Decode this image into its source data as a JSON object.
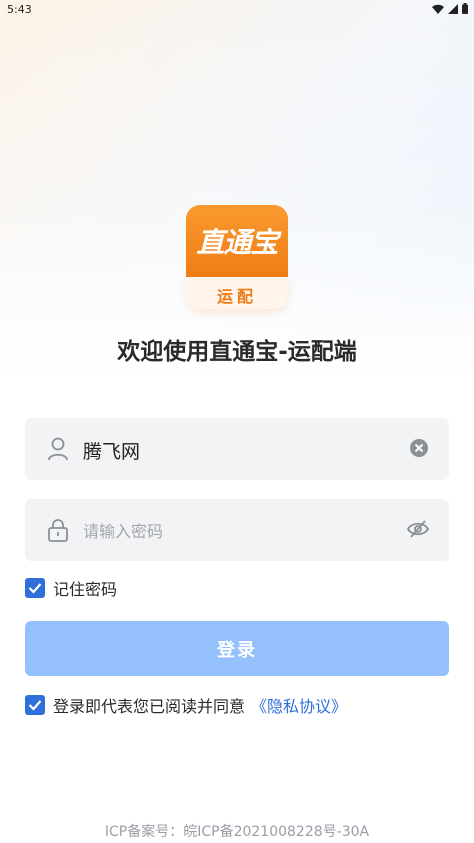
{
  "status_bar": {
    "time": "5:43"
  },
  "logo": {
    "text": "直通宝",
    "sub": "运配"
  },
  "welcome": "欢迎使用直通宝-运配端",
  "username": {
    "value": "腾飞网"
  },
  "password": {
    "value": "",
    "placeholder": "请输入密码"
  },
  "remember": {
    "label": "记住密码",
    "checked": true
  },
  "login_button": {
    "label": "登录"
  },
  "agreement": {
    "text": "登录即代表您已阅读并同意",
    "link": "《隐私协议》",
    "checked": true
  },
  "icp": "ICP备案号：皖ICP备2021008228号-30A",
  "colors": {
    "primary": "#2f6fd9",
    "button": "#94c0fb",
    "logo": "#f07c16"
  }
}
